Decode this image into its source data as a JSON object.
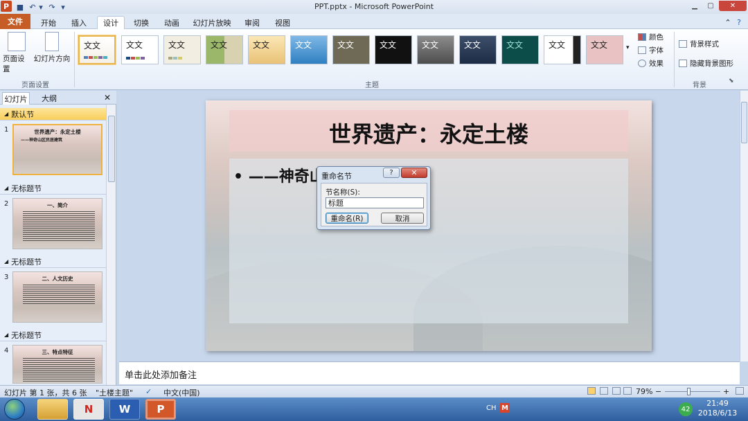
{
  "window": {
    "title": "PPT.pptx - Microsoft PowerPoint",
    "app_logo": "P",
    "min_glyph": "▁",
    "max_glyph": "▢",
    "close_glyph": "✕"
  },
  "quick_access": {
    "save_glyph": "■",
    "undo_glyph": "↶",
    "redo_glyph": "↷",
    "dropdown_glyph": "▾"
  },
  "tabs": {
    "file": "文件",
    "home": "开始",
    "insert": "插入",
    "design": "设计",
    "transitions": "切换",
    "animations": "动画",
    "slideshow": "幻灯片放映",
    "review": "审阅",
    "view": "视图",
    "collapse_glyph": "⌃",
    "help_glyph": "?"
  },
  "ribbon": {
    "page_setup_label": "页面设置",
    "slide_orientation_label": "幻灯片方向",
    "group_page_setup": "页面设置",
    "group_theme": "主题",
    "group_background": "背景",
    "theme_sample": "文文",
    "colors": "颜色",
    "fonts": "字体",
    "effects": "效果",
    "bg_styles": "背景样式",
    "hide_bg": "隐藏背景图形",
    "dialog_launcher_glyph": "⬊"
  },
  "left_panel": {
    "tab_slides": "幻灯片",
    "tab_outline": "大纲",
    "close_glyph": "✕",
    "sections": [
      {
        "name": "默认节"
      },
      {
        "name": "无标题节"
      },
      {
        "name": "无标题节"
      },
      {
        "name": "无标题节"
      }
    ],
    "slides": [
      {
        "num": "1",
        "title": "世界遗产：永定土楼",
        "sub": "——神奇山区民居建筑"
      },
      {
        "num": "2",
        "title": "一、简介"
      },
      {
        "num": "3",
        "title": "二、人文历史"
      },
      {
        "num": "4",
        "title": "三、特点特征"
      }
    ],
    "triangle_glyph": "◢"
  },
  "slide": {
    "title": "世界遗产：永定土楼",
    "bullet": "•  ——神奇山区民居建筑"
  },
  "notes": {
    "placeholder": "单击此处添加备注"
  },
  "status": {
    "slide_info": "幻灯片 第 1 张，共 6 张",
    "theme": "\"土楼主题\"",
    "language": "中文(中国)",
    "zoom": "79%",
    "zoom_out": "−",
    "zoom_in": "+"
  },
  "dialog": {
    "title": "重命名节",
    "help_glyph": "?",
    "close_glyph": "✕",
    "label": "节名称(S):",
    "value": "标题",
    "rename_button": "重命名(R)",
    "cancel_button": "取消"
  },
  "taskbar": {
    "time": "21:49",
    "date": "2018/6/13",
    "lang": "CH",
    "badge": "42",
    "word": "W",
    "ppt": "P",
    "netease": "N"
  }
}
